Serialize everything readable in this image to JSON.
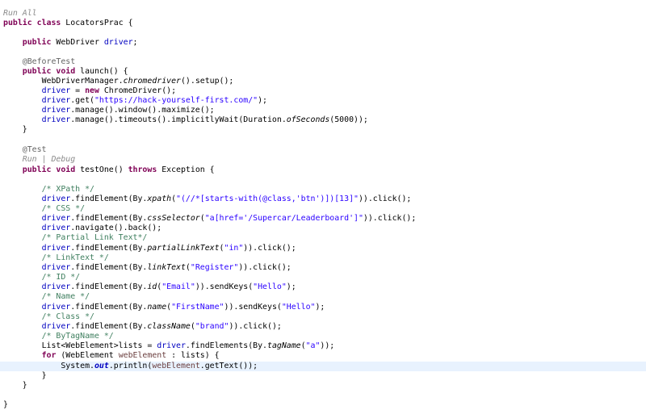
{
  "editor": {
    "lens_run_all": "Run All",
    "lens_run": "Run",
    "lens_separator": " | ",
    "lens_debug": "Debug",
    "class_decl": [
      "public",
      " ",
      "class",
      " LocatorsPrac {"
    ],
    "field_decl": [
      "public",
      " WebDriver ",
      "driver",
      ";"
    ],
    "before_annotation": "@BeforeTest",
    "launch_decl": [
      "public",
      " ",
      "void",
      " launch() {"
    ],
    "l_setup": [
      "WebDriverManager.",
      "chromedriver",
      "().setup();"
    ],
    "l_new_driver": [
      "driver",
      " = ",
      "new",
      " ChromeDriver();"
    ],
    "l_get": [
      "driver",
      ".get(",
      "\"https://hack-yourself-first.com/\"",
      ");"
    ],
    "l_maximize": [
      "driver",
      ".manage().window().maximize();"
    ],
    "l_timeouts": [
      "driver",
      ".manage().timeouts().implicitlyWait(Duration.",
      "ofSeconds",
      "(5000));"
    ],
    "close_brace": "}",
    "test_annotation": "@Test",
    "test_decl": [
      "public",
      " ",
      "void",
      " testOne() ",
      "throws",
      " Exception {"
    ],
    "c_xpath": "/* XPath */",
    "l_xpath": [
      "driver",
      ".findElement(By.",
      "xpath",
      "(",
      "\"(//*[starts-with(@class,'btn')])[13]\"",
      ")).click();"
    ],
    "c_css": "/* CSS */",
    "l_css": [
      "driver",
      ".findElement(By.",
      "cssSelector",
      "(",
      "\"a[href='/Supercar/Leaderboard']\"",
      ")).click();"
    ],
    "l_back": [
      "driver",
      ".navigate().back();"
    ],
    "c_partial": "/* Partial Link Text*/",
    "l_partial": [
      "driver",
      ".findElement(By.",
      "partialLinkText",
      "(",
      "\"in\"",
      ")).click();"
    ],
    "c_linktext": "/* LinkText */",
    "l_linktext": [
      "driver",
      ".findElement(By.",
      "linkText",
      "(",
      "\"Register\"",
      ")).click();"
    ],
    "c_id": "/* ID */",
    "l_id": [
      "driver",
      ".findElement(By.",
      "id",
      "(",
      "\"Email\"",
      ")).sendKeys(",
      "\"Hello\"",
      ");"
    ],
    "c_name": "/* Name */",
    "l_name": [
      "driver",
      ".findElement(By.",
      "name",
      "(",
      "\"FirstName\"",
      ")).sendKeys(",
      "\"Hello\"",
      ");"
    ],
    "c_class": "/* Class */",
    "l_class": [
      "driver",
      ".findElement(By.",
      "className",
      "(",
      "\"brand\"",
      ")).click();"
    ],
    "c_tag": "/* ByTagName */",
    "l_lists": [
      "List<WebElement>lists = ",
      "driver",
      ".findElements(By.",
      "tagName",
      "(",
      "\"a\"",
      "));"
    ],
    "l_for": [
      "for",
      " (WebElement ",
      "webElement",
      " : lists) {"
    ],
    "l_println": [
      "System.",
      "out",
      ".println(",
      "webElement",
      ".getText());"
    ]
  },
  "colors": {
    "keyword": "#7f0055",
    "field": "#0000c0",
    "string": "#2a00ff",
    "comment": "#3f7f5f",
    "annotation": "#646464",
    "code_lens": "#8a8a8a",
    "current_line": "#e8f2fe"
  }
}
